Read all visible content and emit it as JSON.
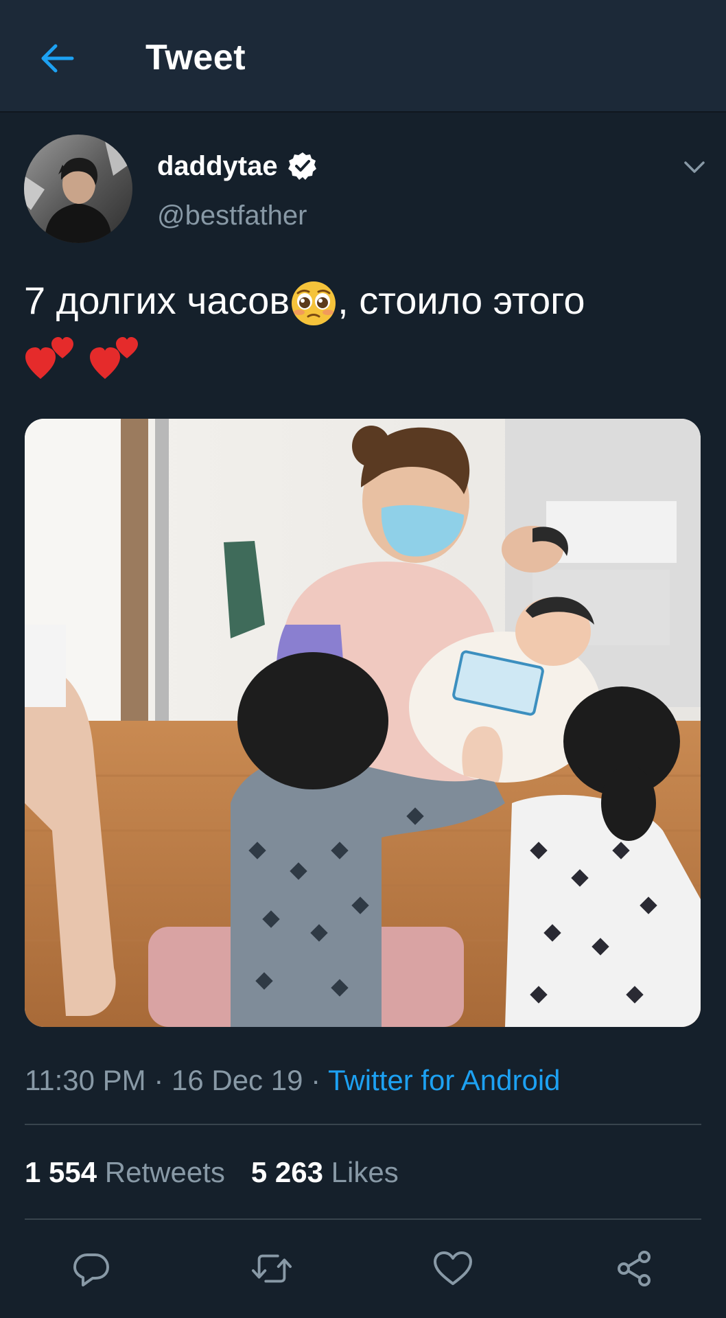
{
  "header": {
    "title": "Tweet"
  },
  "author": {
    "display_name": "daddytae",
    "handle": "@bestfather",
    "verified": true
  },
  "tweet": {
    "text_part1": "7 долгих часов",
    "text_part2": ", стоило этого",
    "emojis": [
      "pleading-face",
      "two-hearts",
      "two-hearts"
    ]
  },
  "meta": {
    "time": "11:30 PM",
    "separator": " · ",
    "date": "16 Dec 19",
    "source": "Twitter for Android"
  },
  "stats": {
    "retweets_count": "1 554",
    "retweets_label": "Retweets",
    "likes_count": "5 263",
    "likes_label": "Likes"
  },
  "icons": {
    "back": "arrow-left-icon",
    "verified": "verified-badge-icon",
    "caret": "chevron-down-icon",
    "reply": "reply-icon",
    "retweet": "retweet-icon",
    "like": "heart-icon",
    "share": "share-icon"
  },
  "colors": {
    "background": "#15202b",
    "header": "#1c2938",
    "accent": "#1da1f2",
    "secondary_text": "#8899a6",
    "divider": "#38444d"
  }
}
